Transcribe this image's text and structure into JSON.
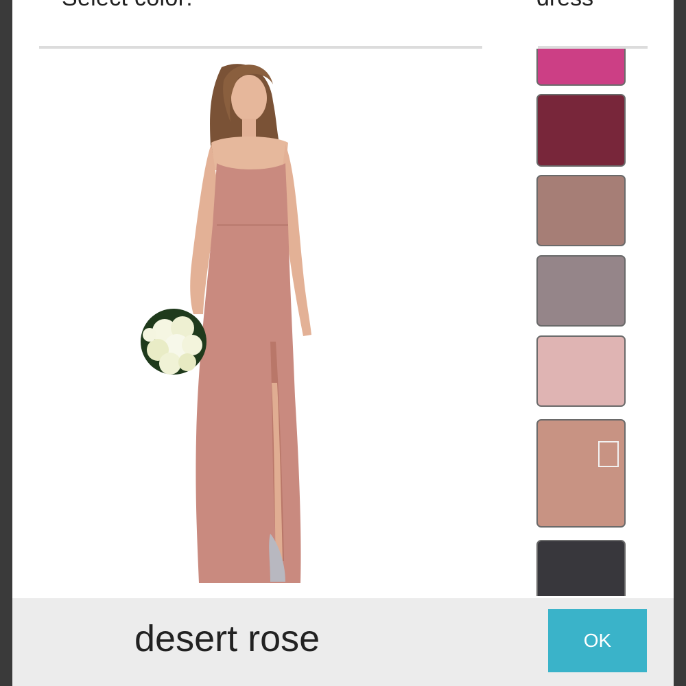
{
  "header": {
    "title": "Select color:",
    "right_label": "dress"
  },
  "swatches": [
    {
      "name": "swatch-magenta",
      "color": "#cc3f85"
    },
    {
      "name": "swatch-burgundy",
      "color": "#78263a"
    },
    {
      "name": "swatch-mauve-brown",
      "color": "#a67e76"
    },
    {
      "name": "swatch-gray-mauve",
      "color": "#958589"
    },
    {
      "name": "swatch-light-pink",
      "color": "#dfb4b3"
    },
    {
      "name": "swatch-desert-rose",
      "color": "#c89383",
      "selected": true
    },
    {
      "name": "swatch-charcoal",
      "color": "#38373c"
    }
  ],
  "footer": {
    "selected_color": "desert rose",
    "ok_label": "OK"
  },
  "colors": {
    "accent": "#3ab3c9",
    "dress": "#c98a7f",
    "footer_bg": "#ececec"
  }
}
